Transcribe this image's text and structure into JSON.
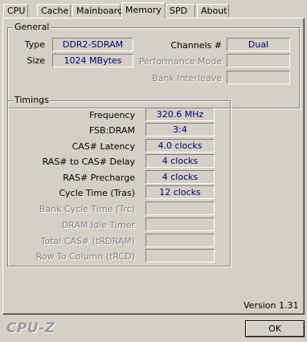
{
  "tabs": [
    {
      "label": "CPU"
    },
    {
      "label": "Cache"
    },
    {
      "label": "Mainboard"
    },
    {
      "label": "Memory"
    },
    {
      "label": "SPD"
    },
    {
      "label": "About"
    }
  ],
  "general": {
    "title": "General",
    "type_label": "Type",
    "type_value": "DDR2-SDRAM",
    "size_label": "Size",
    "size_value": "1024 MBytes",
    "channels_label": "Channels #",
    "channels_value": "Dual",
    "perf_mode_label": "Performance Mode",
    "perf_mode_value": "",
    "bank_interleave_label": "Bank Interleave",
    "bank_interleave_value": ""
  },
  "timings": {
    "title": "Timings",
    "rows": [
      {
        "label": "Frequency",
        "value": "320.6 MHz"
      },
      {
        "label": "FSB:DRAM",
        "value": "3:4"
      },
      {
        "label": "CAS# Latency",
        "value": "4.0 clocks"
      },
      {
        "label": "RAS# to CAS# Delay",
        "value": "4 clocks"
      },
      {
        "label": "RAS# Precharge",
        "value": "4 clocks"
      },
      {
        "label": "Cycle Time (Tras)",
        "value": "12 clocks"
      },
      {
        "label": "Bank Cycle Time (Trc)",
        "value": ""
      },
      {
        "label": "DRAM Idle Timer",
        "value": ""
      },
      {
        "label": "Total CAS# (tRDRAM)",
        "value": ""
      },
      {
        "label": "Row To Column (tRCD)",
        "value": ""
      }
    ]
  },
  "footer": {
    "version": "Version 1.31",
    "brand": "CPU-Z",
    "ok_label": "OK"
  }
}
